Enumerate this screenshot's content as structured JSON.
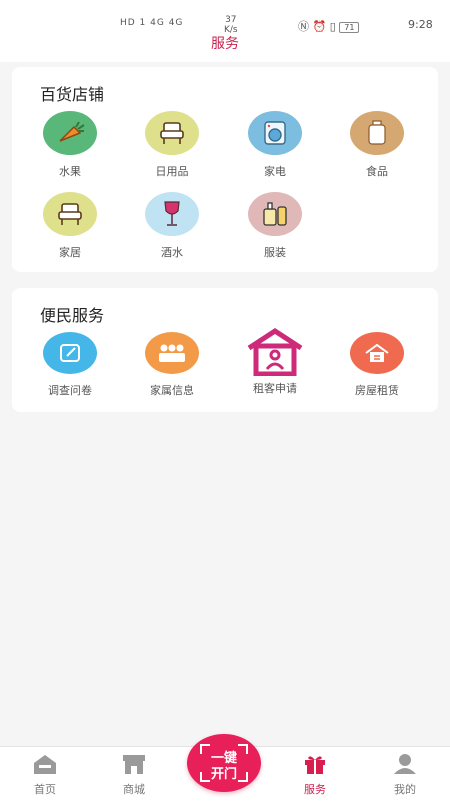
{
  "status": {
    "left": "HD 1 4G 4G",
    "speed_value": "37",
    "speed_unit": "K/s",
    "battery": "71",
    "time": "9:28"
  },
  "page": {
    "title": "服务"
  },
  "store": {
    "title": "百货店铺",
    "items": [
      {
        "label": "水果",
        "icon": "carrot-icon",
        "color": "#5ab77a"
      },
      {
        "label": "日用品",
        "icon": "armchair-icon",
        "color": "#dfe08c"
      },
      {
        "label": "家电",
        "icon": "washing-machine-icon",
        "color": "#7cbde0"
      },
      {
        "label": "食品",
        "icon": "jar-icon",
        "color": "#d4a870"
      },
      {
        "label": "家居",
        "icon": "armchair-icon",
        "color": "#dfe08c"
      },
      {
        "label": "酒水",
        "icon": "wine-glass-icon",
        "color": "#bfe3f2"
      },
      {
        "label": "服装",
        "icon": "cosmetics-icon",
        "color": "#e0b8b8"
      }
    ]
  },
  "services": {
    "title": "便民服务",
    "items": [
      {
        "label": "调查问卷",
        "icon": "edit-icon",
        "color": "#45b6e8"
      },
      {
        "label": "家属信息",
        "icon": "family-icon",
        "color": "#f39a48"
      },
      {
        "label": "租客申请",
        "icon": "house-person-icon",
        "color": "#cd2a7a"
      },
      {
        "label": "房屋租赁",
        "icon": "house-icon",
        "color": "#f06a50"
      }
    ]
  },
  "tabs": [
    {
      "label": "首页",
      "icon": "home-icon"
    },
    {
      "label": "商城",
      "icon": "shop-icon"
    },
    {
      "label": "服务",
      "icon": "gift-icon"
    },
    {
      "label": "我的",
      "icon": "user-icon"
    }
  ],
  "open_button": {
    "line1": "一键",
    "line2": "开门"
  },
  "colors": {
    "accent": "#c8234f",
    "open_button": "#e8205a"
  }
}
